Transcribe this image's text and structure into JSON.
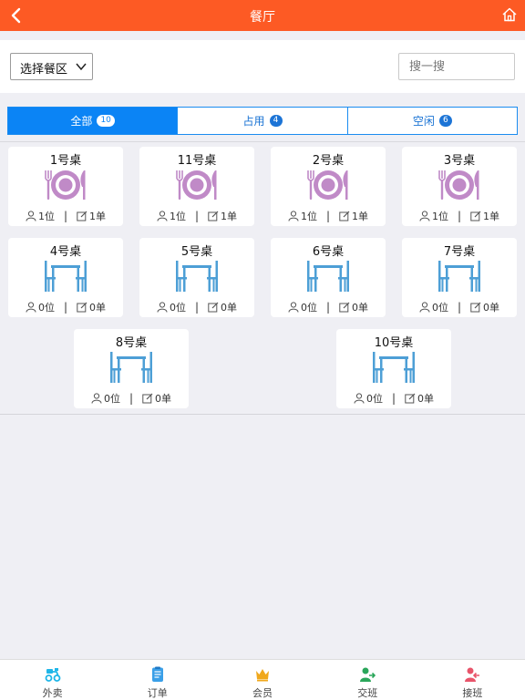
{
  "header": {
    "title": "餐厅",
    "bg_color": "#fd5a24"
  },
  "filter": {
    "zone_select_label": "选择餐区",
    "search_placeholder": "搜一搜"
  },
  "tabs": [
    {
      "label": "全部",
      "count": "10",
      "active": true
    },
    {
      "label": "占用",
      "count": "4",
      "active": false
    },
    {
      "label": "空闲",
      "count": "6",
      "active": false
    }
  ],
  "tables": [
    {
      "name": "1号桌",
      "status": "occupied",
      "guests": "1位",
      "orders": "1单"
    },
    {
      "name": "11号桌",
      "status": "occupied",
      "guests": "1位",
      "orders": "1单"
    },
    {
      "name": "2号桌",
      "status": "occupied",
      "guests": "1位",
      "orders": "1单"
    },
    {
      "name": "3号桌",
      "status": "occupied",
      "guests": "1位",
      "orders": "1单"
    },
    {
      "name": "4号桌",
      "status": "free",
      "guests": "0位",
      "orders": "0单"
    },
    {
      "name": "5号桌",
      "status": "free",
      "guests": "0位",
      "orders": "0单"
    },
    {
      "name": "6号桌",
      "status": "free",
      "guests": "0位",
      "orders": "0单"
    },
    {
      "name": "7号桌",
      "status": "free",
      "guests": "0位",
      "orders": "0单"
    },
    {
      "name": "8号桌",
      "status": "free",
      "guests": "0位",
      "orders": "0单"
    },
    {
      "name": "10号桌",
      "status": "free",
      "guests": "0位",
      "orders": "0单"
    }
  ],
  "tabbar": [
    {
      "label": "外卖",
      "icon": "delivery-icon",
      "color": "#1fb6e8"
    },
    {
      "label": "订单",
      "icon": "order-icon",
      "color": "#3a9fe8"
    },
    {
      "label": "会员",
      "icon": "crown-icon",
      "color": "#f0a81c"
    },
    {
      "label": "交班",
      "icon": "handover-icon",
      "color": "#2aa65a"
    },
    {
      "label": "接班",
      "icon": "takeover-icon",
      "color": "#e8546a"
    }
  ]
}
